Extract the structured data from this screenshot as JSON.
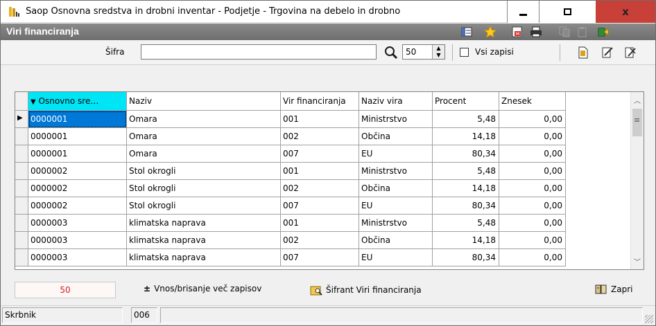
{
  "window": {
    "title": "Saop Osnovna sredstva in drobni inventar - Podjetje - Trgovina na debelo in drobno",
    "close_glyph": "x"
  },
  "form": {
    "title": "Viri financiranja"
  },
  "search": {
    "label": "Šifra",
    "value": "",
    "count_value": "50",
    "all_records_label": "Vsi zapisi",
    "all_records_checked": false
  },
  "grid": {
    "columns": [
      "Osnovno sre…",
      "Naziv",
      "Vir financiranja",
      "Naziv vira",
      "Procent",
      "Znesek"
    ],
    "sort_indicator": "▼",
    "row_pointer": "▶",
    "rows": [
      {
        "osnovno": "0000001",
        "naziv": "Omara",
        "vir": "001",
        "naziv_vira": "Ministrstvo",
        "procent": "5,48",
        "znesek": "0,00"
      },
      {
        "osnovno": "0000001",
        "naziv": "Omara",
        "vir": "002",
        "naziv_vira": "Občina",
        "procent": "14,18",
        "znesek": "0,00"
      },
      {
        "osnovno": "0000001",
        "naziv": "Omara",
        "vir": "007",
        "naziv_vira": "EU",
        "procent": "80,34",
        "znesek": "0,00"
      },
      {
        "osnovno": "0000002",
        "naziv": "Stol okrogli",
        "vir": "001",
        "naziv_vira": "Ministrstvo",
        "procent": "5,48",
        "znesek": "0,00"
      },
      {
        "osnovno": "0000002",
        "naziv": "Stol okrogli",
        "vir": "002",
        "naziv_vira": "Občina",
        "procent": "14,18",
        "znesek": "0,00"
      },
      {
        "osnovno": "0000002",
        "naziv": "Stol okrogli",
        "vir": "007",
        "naziv_vira": "EU",
        "procent": "80,34",
        "znesek": "0,00"
      },
      {
        "osnovno": "0000003",
        "naziv": "klimatska naprava",
        "vir": "001",
        "naziv_vira": "Ministrstvo",
        "procent": "5,48",
        "znesek": "0,00"
      },
      {
        "osnovno": "0000003",
        "naziv": "klimatska naprava",
        "vir": "002",
        "naziv_vira": "Občina",
        "procent": "14,18",
        "znesek": "0,00"
      },
      {
        "osnovno": "0000003",
        "naziv": "klimatska naprava",
        "vir": "007",
        "naziv_vira": "EU",
        "procent": "80,34",
        "znesek": "0,00"
      }
    ]
  },
  "bottom": {
    "record_count": "50",
    "bulk_label": "Vnos/brisanje več zapisov",
    "bulk_prefix": "±",
    "sifrant_label": "Šifrant Viri financiranja",
    "close_label": "Zapri"
  },
  "status": {
    "user_label": "Skrbnik",
    "code": "006"
  },
  "colors": {
    "sorted_header": "#00e5f5",
    "selection": "#0078d7",
    "close_button": "#c84038",
    "count_text": "#d42020"
  }
}
